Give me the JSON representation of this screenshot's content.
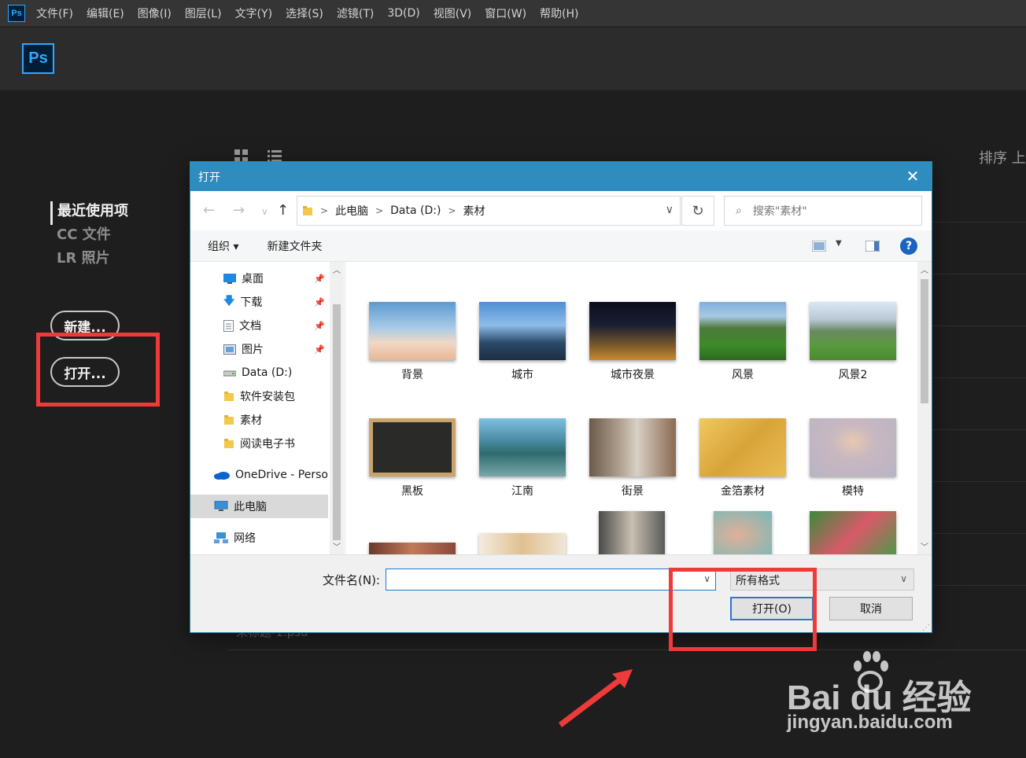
{
  "app": {
    "logo": "Ps"
  },
  "menubar": {
    "items": [
      "文件(F)",
      "编辑(E)",
      "图像(I)",
      "图层(L)",
      "文字(Y)",
      "选择(S)",
      "滤镜(T)",
      "3D(D)",
      "视图(V)",
      "窗口(W)",
      "帮助(H)"
    ]
  },
  "home": {
    "nav": [
      "最近使用项",
      "CC 文件",
      "LR 照片"
    ],
    "new_button": "新建...",
    "open_button": "打开...",
    "sort_label": "排序 上",
    "recent_file_partial": "未标题-1.psd"
  },
  "dialog": {
    "title": "打开",
    "breadcrumb": [
      "此电脑",
      "Data (D:)",
      "素材"
    ],
    "search_placeholder": "搜索\"素材\"",
    "organize": "组织 ▾",
    "new_folder": "新建文件夹",
    "tree": [
      {
        "label": "桌面",
        "icon": "desktop-icon",
        "pinned": true
      },
      {
        "label": "下载",
        "icon": "download-icon",
        "pinned": true
      },
      {
        "label": "文档",
        "icon": "document-icon",
        "pinned": true
      },
      {
        "label": "图片",
        "icon": "picture-icon",
        "pinned": true
      },
      {
        "label": "Data (D:)",
        "icon": "drive-icon",
        "pinned": false
      },
      {
        "label": "软件安装包",
        "icon": "folder-icon",
        "pinned": false
      },
      {
        "label": "素材",
        "icon": "folder-icon",
        "pinned": false
      },
      {
        "label": "阅读电子书",
        "icon": "folder-icon",
        "pinned": false
      },
      {
        "label": "OneDrive - Perso",
        "icon": "onedrive-icon",
        "pinned": false
      },
      {
        "label": "此电脑",
        "icon": "computer-icon",
        "pinned": false
      },
      {
        "label": "网络",
        "icon": "network-icon",
        "pinned": false
      }
    ],
    "files": [
      {
        "name": "背景"
      },
      {
        "name": "城市"
      },
      {
        "name": "城市夜景"
      },
      {
        "name": "风景"
      },
      {
        "name": "风景2"
      },
      {
        "name": "黑板"
      },
      {
        "name": "江南"
      },
      {
        "name": "街景"
      },
      {
        "name": "金箔素材"
      },
      {
        "name": "模特"
      }
    ],
    "filename_label": "文件名(N):",
    "filename_value": "",
    "filter": "所有格式",
    "open_button": "打开(O)",
    "cancel_button": "取消"
  },
  "watermark": {
    "brand": "Bai du 经验",
    "url": "jingyan.baidu.com"
  },
  "colors": {
    "ps_blue": "#31a8ff",
    "dialog_title_bar": "#2f8cbf",
    "annotation_red": "#ef3a3a"
  }
}
